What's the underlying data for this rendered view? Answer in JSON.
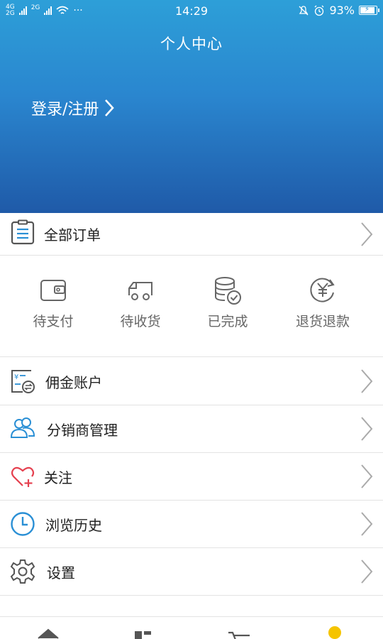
{
  "status_bar": {
    "network_left": "4G",
    "network_left2": "2G",
    "network_mid": "2G",
    "more": "···",
    "time": "14:29",
    "battery": "93%",
    "battery_level": 0.93
  },
  "header": {
    "title": "个人中心",
    "login_label": "登录/注册"
  },
  "all_orders": {
    "label": "全部订单"
  },
  "order_status": [
    {
      "label": "待支付",
      "icon": "wallet-icon"
    },
    {
      "label": "待收货",
      "icon": "truck-icon"
    },
    {
      "label": "已完成",
      "icon": "coins-check-icon"
    },
    {
      "label": "退货退款",
      "icon": "yuan-refund-icon"
    }
  ],
  "menu": [
    {
      "label": "佣金账户",
      "icon": "commission-account-icon"
    },
    {
      "label": "分销商管理",
      "icon": "users-icon"
    },
    {
      "label": "关注",
      "icon": "heart-plus-icon"
    },
    {
      "label": "浏览历史",
      "icon": "clock-icon"
    },
    {
      "label": "设置",
      "icon": "gear-icon"
    }
  ],
  "colors": {
    "header_top": "#2d9fd8",
    "header_bottom": "#1f5aa8",
    "accent_blue": "#2a8fd5",
    "heart_red": "#e5404f",
    "tab_dot": "#f5c400"
  },
  "tabs": [
    "home-icon",
    "category-icon",
    "cart-icon",
    "profile-icon"
  ]
}
